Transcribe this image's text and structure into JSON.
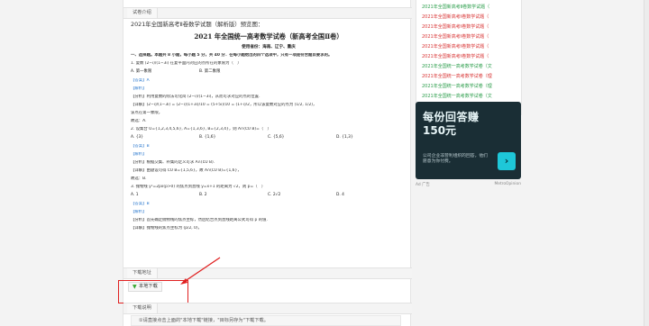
{
  "intro_tab": "试卷介绍",
  "doc": {
    "top_title": "2021年全国新高考Ⅱ卷数学试题（解析版）预览图：",
    "title": "2021 年普通高等学校招生全国统一考试数学试卷（新高考全国Ⅱ卷）",
    "title_short": "2021 年全国统一高考数学试卷（新高考全国Ⅱ卷）",
    "subtitle": "使用省份：海南、辽宁、重庆",
    "section1": "一、选择题。本题共 8 小题，每小题 5 分，共 40 分．在每小题给出的四个选项中，只有一项是符合题目要求的。",
    "q1": "1. 复数 (2−i)/(1−3i) 在复平面内对应的点所在的象限为（　）",
    "q1_opts": [
      "A. 第一象限",
      "B. 第二象限",
      "C. 第三象限",
      "D. 第四象限"
    ],
    "answer_tag": "【答案】A",
    "analysis_tag": "【解析】",
    "analysis1": "【分析】利用复数的除法可化简 (2−i)/(1−3i)，从而可求对应的点的位置.",
    "detail1": "【详解】(2−i)/(1−3i) = (2−i)(1+3i)/10 = (5+5i)/10 = (1+i)/2，所以该复数对应的点为 (1/2, 1/2)，",
    "detail1b": "该点在第一象限，",
    "choose1": "故选：A.",
    "q2": "2. 设集合 U={1,2,3,4,5,6}, A={1,3,6}, B={2,3,4}，则 A∩(∁U B)=（　）",
    "q2_opts": [
      "A. {3}",
      "B. {1,6}",
      "C. {5,6}",
      "D. {1,3}"
    ],
    "answer2": "【答案】B",
    "analysis2": "【分析】根据交集、补集的定义可求 A∩(∁U B).",
    "detail2": "【详解】由题设可得 ∁U B={1,5,6}，故 A∩(∁U B)={1,6}，",
    "choose2": "故选：B.",
    "q3": "3. 抛物线 y²=2px(p>0) 的焦点到直线 y=x+1 的距离为 √2，则 p=（　）",
    "q3_opts": [
      "A. 1",
      "B. 2",
      "C. 2√2",
      "D. 4"
    ],
    "answer3": "【答案】B",
    "analysis3": "【分析】首先确定抛物线的焦点坐标，然后结合点到直线距离公式可得 p 的值.",
    "detail3": "【详解】抛物线的焦点坐标为 (p/2, 0)，"
  },
  "download_tab": "下载地址",
  "download_button": "本地下载",
  "notes_tab": "下载说明",
  "note_text": "①请直接点击上面的\"本地下载\"链接，\"目标另存为\"下载下载。",
  "side_links": [
    {
      "text": "2021年全国新高考Ⅱ卷数学试题（",
      "color": "#2a9d4a"
    },
    {
      "text": "2021年全国新高考Ⅰ卷数学试题（",
      "color": "#d83232"
    },
    {
      "text": "2021年全国新高考Ⅰ卷数学试题（",
      "color": "#d83232"
    },
    {
      "text": "2021年全国新高考Ⅰ卷数学试题（",
      "color": "#d83232"
    },
    {
      "text": "2021年全国新高考Ⅰ卷数学试题（",
      "color": "#d83232"
    },
    {
      "text": "2021年全国新高考Ⅰ卷数学试题（",
      "color": "#d83232"
    },
    {
      "text": "2021年全国统一高考数学试卷（文",
      "color": "#2a9d4a"
    },
    {
      "text": "2021年全国统一高考数学试卷（理",
      "color": "#d83232"
    },
    {
      "text": "2021年全国统一高考数学试卷（理",
      "color": "#2a9d4a"
    },
    {
      "text": "2021年全国统一高考数学试卷（文",
      "color": "#2a9d4a"
    },
    {
      "text": "2021年全国高考甲卷数学（文）试",
      "color": "#d83232"
    }
  ],
  "ad": {
    "title": "每份回答赚",
    "amount": "150元",
    "desc": "公司企业非营利组织的回答，他们愿意为你付费。",
    "go": "›",
    "foot_left": "Ad 广告",
    "foot_right": "MetroOpinion"
  },
  "colors": {
    "accent_red": "#e02020",
    "ad_bg": "#1a2e35",
    "ad_cyan": "#1ec7d8"
  }
}
